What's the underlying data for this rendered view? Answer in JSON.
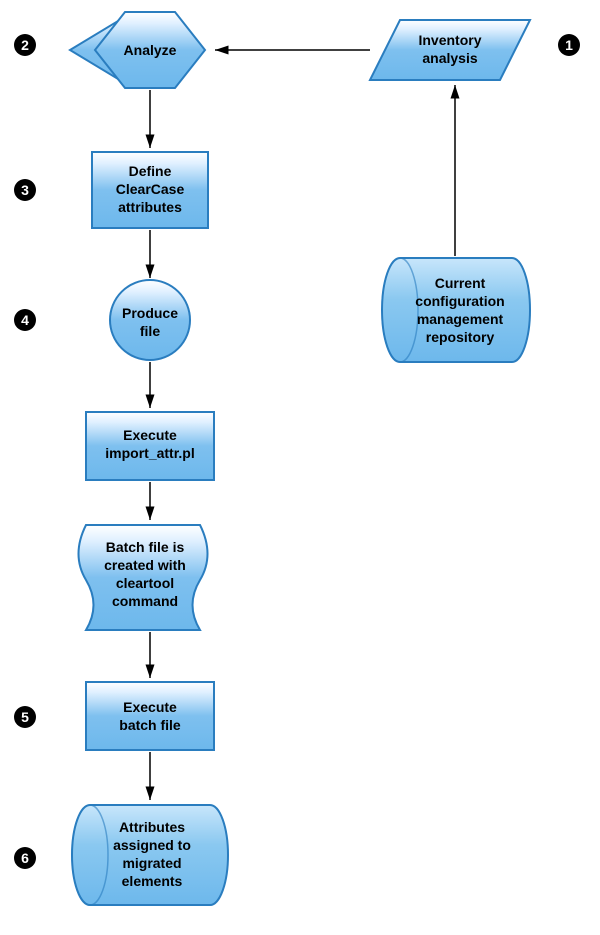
{
  "flowchart": {
    "badges": {
      "b1": "1",
      "b2": "2",
      "b3": "3",
      "b4": "4",
      "b5": "5",
      "b6": "6"
    },
    "nodes": {
      "inventory": {
        "line1": "Inventory",
        "line2": "analysis"
      },
      "analyze": {
        "line1": "Analyze"
      },
      "define": {
        "line1": "Define",
        "line2": "ClearCase",
        "line3": "attributes"
      },
      "produce": {
        "line1": "Produce",
        "line2": "file"
      },
      "execImport": {
        "line1": "Execute",
        "line2": "import_attr.pl"
      },
      "batch": {
        "line1": "Batch file is",
        "line2": "created with",
        "line3": "cleartool",
        "line4": "command"
      },
      "execBatch": {
        "line1": "Execute",
        "line2": "batch file"
      },
      "attributes": {
        "line1": "Attributes",
        "line2": "assigned to",
        "line3": "migrated",
        "line4": "elements"
      },
      "repo": {
        "line1": "Current",
        "line2": "configuration",
        "line3": "management",
        "line4": "repository"
      }
    }
  }
}
